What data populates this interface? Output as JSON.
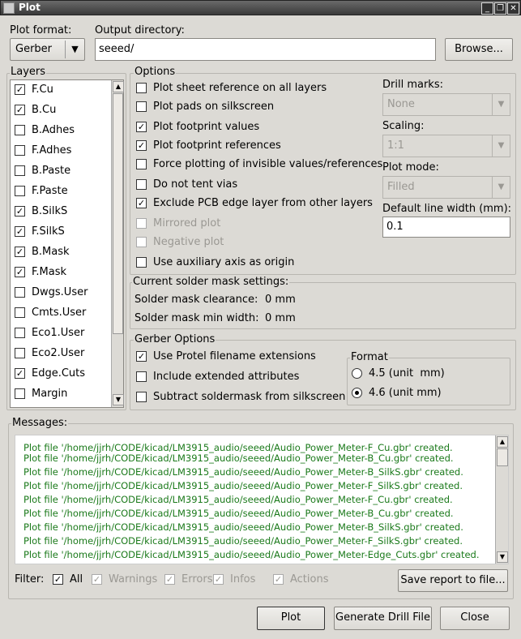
{
  "window": {
    "title": "Plot"
  },
  "plot_format": {
    "label": "Plot format:",
    "value": "Gerber"
  },
  "output_dir": {
    "label": "Output directory:",
    "value": "seeed/",
    "browse": "Browse..."
  },
  "layers": {
    "title": "Layers",
    "items": [
      {
        "label": "F.Cu",
        "checked": true
      },
      {
        "label": "B.Cu",
        "checked": true
      },
      {
        "label": "B.Adhes",
        "checked": false
      },
      {
        "label": "F.Adhes",
        "checked": false
      },
      {
        "label": "B.Paste",
        "checked": false
      },
      {
        "label": "F.Paste",
        "checked": false
      },
      {
        "label": "B.SilkS",
        "checked": true
      },
      {
        "label": "F.SilkS",
        "checked": true
      },
      {
        "label": "B.Mask",
        "checked": true
      },
      {
        "label": "F.Mask",
        "checked": true
      },
      {
        "label": "Dwgs.User",
        "checked": false
      },
      {
        "label": "Cmts.User",
        "checked": false
      },
      {
        "label": "Eco1.User",
        "checked": false
      },
      {
        "label": "Eco2.User",
        "checked": false
      },
      {
        "label": "Edge.Cuts",
        "checked": true
      },
      {
        "label": "Margin",
        "checked": false
      }
    ]
  },
  "options": {
    "title": "Options",
    "items": [
      {
        "label": "Plot sheet reference on all layers",
        "checked": false,
        "enabled": true
      },
      {
        "label": "Plot pads on silkscreen",
        "checked": false,
        "enabled": true
      },
      {
        "label": "Plot footprint values",
        "checked": true,
        "enabled": true
      },
      {
        "label": "Plot footprint references",
        "checked": true,
        "enabled": true
      },
      {
        "label": "Force plotting of invisible values/references",
        "checked": false,
        "enabled": true
      },
      {
        "label": "Do not tent vias",
        "checked": false,
        "enabled": true
      },
      {
        "label": "Exclude PCB edge layer from other layers",
        "checked": true,
        "enabled": true
      },
      {
        "label": "Mirrored plot",
        "checked": false,
        "enabled": false
      },
      {
        "label": "Negative plot",
        "checked": false,
        "enabled": false
      },
      {
        "label": "Use auxiliary axis as origin",
        "checked": false,
        "enabled": true
      }
    ],
    "drill_marks": {
      "label": "Drill marks:",
      "value": "None"
    },
    "scaling": {
      "label": "Scaling:",
      "value": "1:1"
    },
    "plot_mode": {
      "label": "Plot mode:",
      "value": "Filled"
    },
    "line_width": {
      "label": "Default line width (mm):",
      "value": "0.1"
    }
  },
  "solder_mask": {
    "title": "Current solder mask settings:",
    "clearance_label": "Solder mask clearance:",
    "clearance_value": "0 mm",
    "min_width_label": "Solder mask min width:",
    "min_width_value": "0 mm"
  },
  "gerber": {
    "title": "Gerber Options",
    "items": [
      {
        "label": "Use Protel filename extensions",
        "checked": true
      },
      {
        "label": "Include extended attributes",
        "checked": false
      },
      {
        "label": "Subtract soldermask from silkscreen",
        "checked": false
      }
    ],
    "format": {
      "title": "Format",
      "options": [
        {
          "label": "4.5 (unit  mm)",
          "selected": false
        },
        {
          "label": "4.6 (unit mm)",
          "selected": true
        }
      ]
    }
  },
  "messages": {
    "title": "Messages:",
    "lines": [
      "Plot file '/home/jjrh/CODE/kicad/LM3915_audio/seeed/Audio_Power_Meter-F_Cu.gbr' created.",
      "Plot file '/home/jjrh/CODE/kicad/LM3915_audio/seeed/Audio_Power_Meter-B_Cu.gbr' created.",
      "Plot file '/home/jjrh/CODE/kicad/LM3915_audio/seeed/Audio_Power_Meter-B_SilkS.gbr' created.",
      "Plot file '/home/jjrh/CODE/kicad/LM3915_audio/seeed/Audio_Power_Meter-F_SilkS.gbr' created.",
      "Plot file '/home/jjrh/CODE/kicad/LM3915_audio/seeed/Audio_Power_Meter-F_Cu.gbr' created.",
      "Plot file '/home/jjrh/CODE/kicad/LM3915_audio/seeed/Audio_Power_Meter-B_Cu.gbr' created.",
      "Plot file '/home/jjrh/CODE/kicad/LM3915_audio/seeed/Audio_Power_Meter-B_SilkS.gbr' created.",
      "Plot file '/home/jjrh/CODE/kicad/LM3915_audio/seeed/Audio_Power_Meter-F_SilkS.gbr' created.",
      "Plot file '/home/jjrh/CODE/kicad/LM3915_audio/seeed/Audio_Power_Meter-Edge_Cuts.gbr' created."
    ],
    "color": "#1b7a1b",
    "filter_label": "Filter:",
    "filters": [
      {
        "label": "All",
        "checked": true,
        "enabled": true
      },
      {
        "label": "Warnings",
        "checked": true,
        "enabled": false
      },
      {
        "label": "Errors",
        "checked": true,
        "enabled": false
      },
      {
        "label": "Infos",
        "checked": true,
        "enabled": false
      },
      {
        "label": "Actions",
        "checked": true,
        "enabled": false
      }
    ],
    "save_report": "Save report to file..."
  },
  "buttons": {
    "plot": "Plot",
    "drill": "Generate Drill File",
    "close": "Close"
  }
}
